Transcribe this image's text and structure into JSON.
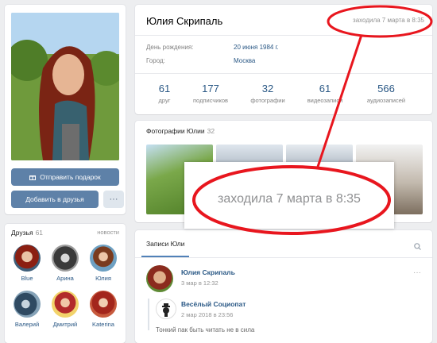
{
  "profile": {
    "name": "Юлия Скрипаль",
    "last_seen": "заходила 7 марта в 8:35",
    "birthday_label": "День рождения:",
    "birthday_value": "20 июня 1984 г.",
    "city_label": "Город:",
    "city_value": "Москва",
    "counters": [
      {
        "value": "61",
        "label": "друг"
      },
      {
        "value": "177",
        "label": "подписчиков"
      },
      {
        "value": "32",
        "label": "фотографии"
      },
      {
        "value": "61",
        "label": "видеозаписи"
      },
      {
        "value": "566",
        "label": "аудиозаписей"
      }
    ]
  },
  "actions": {
    "gift_label": "Отправить подарок",
    "add_friend_label": "Добавить в друзья",
    "more_label": "···"
  },
  "friends": {
    "title": "Друзья",
    "count": "61",
    "more_label": "новости",
    "items": [
      {
        "name": "Blue"
      },
      {
        "name": "Арина"
      },
      {
        "name": "Юлия"
      },
      {
        "name": "Валерий"
      },
      {
        "name": "Дмитрий"
      },
      {
        "name": "Katerina"
      }
    ]
  },
  "photos": {
    "title": "Фотографии Юлии",
    "count": "32"
  },
  "wall": {
    "tab_label": "Записи Юли",
    "post": {
      "author": "Юлия Скрипаль",
      "date": "3 мар в 12:32",
      "dots": "···"
    },
    "repost": {
      "author": "Весёлый Социопат",
      "date": "2 мар 2018 в 23:56",
      "text": "Тонкий пак быть читать не в сила"
    }
  },
  "zoom": {
    "text": "заходила 7 марта в 8:35"
  },
  "colors": {
    "accent": "#5e81a8",
    "link": "#2a5885",
    "annotation": "#e8161e"
  }
}
